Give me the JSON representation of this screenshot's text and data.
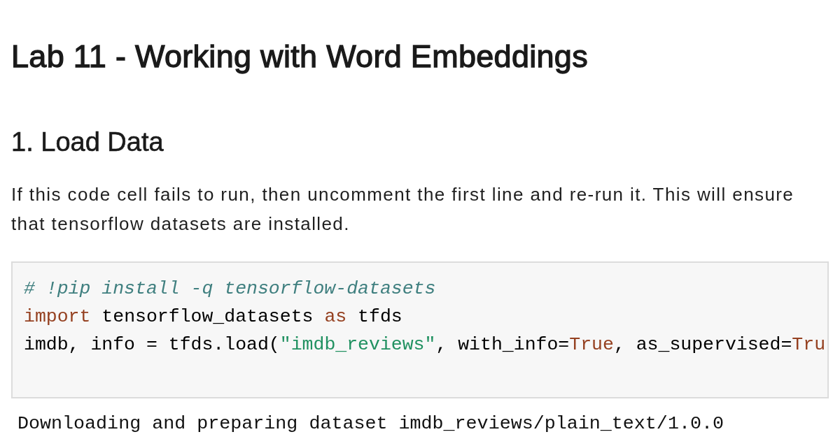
{
  "title": "Lab 11 - Working with Word Embeddings",
  "sections": [
    {
      "heading": "1. Load Data",
      "paragraph": "If this code cell fails to run, then uncomment the first line and re-run it. This will ensure that tensorflow datasets are installed.",
      "code_cell": {
        "lines": [
          [
            {
              "kind": "comment",
              "text": "# !pip install -q tensorflow-datasets"
            }
          ],
          [
            {
              "kind": "keyword",
              "text": "import"
            },
            {
              "kind": "plain",
              "text": " tensorflow_datasets "
            },
            {
              "kind": "keyword",
              "text": "as"
            },
            {
              "kind": "plain",
              "text": " tfds"
            }
          ],
          [
            {
              "kind": "plain",
              "text": "imdb, info = tfds.load("
            },
            {
              "kind": "string",
              "text": "\"imdb_reviews\""
            },
            {
              "kind": "plain",
              "text": ", with_info="
            },
            {
              "kind": "constant",
              "text": "True"
            },
            {
              "kind": "plain",
              "text": ", as_supervised="
            },
            {
              "kind": "constant",
              "text": "Tru"
            }
          ]
        ]
      },
      "output": "Downloading and preparing dataset imdb_reviews/plain_text/1.0.0"
    }
  ]
}
